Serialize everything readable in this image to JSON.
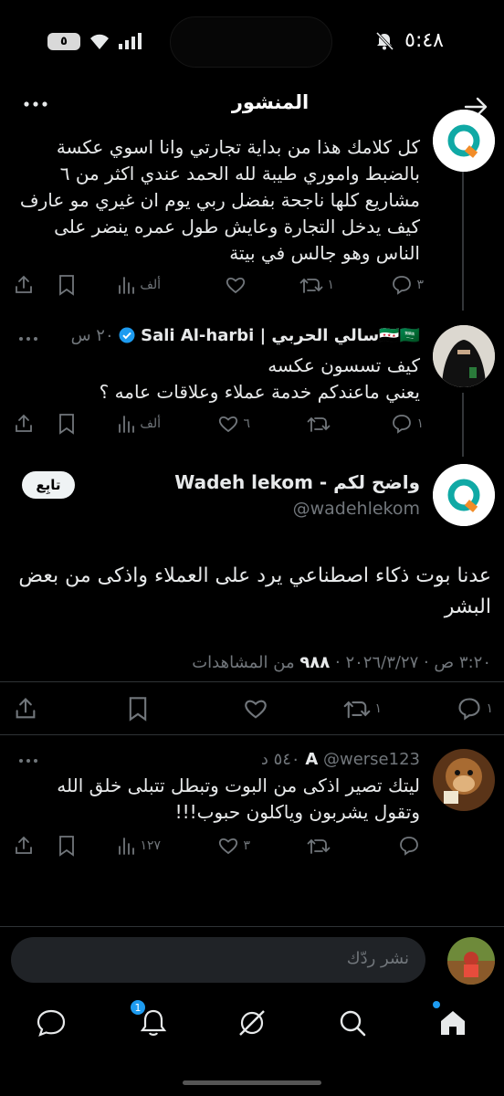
{
  "status_bar": {
    "time": "٥:٤٨",
    "battery": "٥"
  },
  "header": {
    "title": "المنشور"
  },
  "posts": [
    {
      "text": "كل كلامك هذا من بداية تجارتي وانا اسوي عكسة بالضبط واموري طيبة لله الحمد عندي اكثر من ٦ مشاريع كلها ناجحة بفضل ربي يوم ان غيري مو عارف كيف يدخل التجارة وعايش طول عمره ينضر على الناس وهو جالس في بيتة",
      "stats": {
        "replies": "٣",
        "reposts": "١",
        "likes": "",
        "views": "ألف"
      }
    },
    {
      "author_name": "🇸🇾🇸🇦سالي الحربي | Sali Al-harbi",
      "time": "٢٠ س",
      "text": "كيف تسسون عكسه\nيعني ماعندكم خدمة عملاء وعلاقات عامه ؟",
      "stats": {
        "replies": "١",
        "reposts": "",
        "likes": "٦",
        "views": "ألف"
      }
    }
  ],
  "main_post": {
    "author_name": "واضح لكم - Wadeh lekom",
    "handle": "@wadehlekom",
    "follow_label": "تابِع",
    "text": "عدنا بوت ذكاء اصطناعي يرد على العملاء واذكى من بعض البشر",
    "timestamp": "٣:٢٠ ص · ٢٠٢٦/٣/٢٧ · ",
    "views_count": "٩٨٨",
    "views_label": " من المشاهدات",
    "stats": {
      "replies": "١",
      "reposts": "١",
      "likes": "",
      "bookmarks": ""
    }
  },
  "reply": {
    "author_name": "A",
    "handle": "@werse123",
    "time": "٥٤٠ د",
    "text": "ليتك تصير اذكى من البوت وتبطل تتبلى خلق الله وتقول يشربون وياكلون حبوب!!!",
    "stats": {
      "replies": "",
      "reposts": "",
      "likes": "٣",
      "views": "١٢٧"
    }
  },
  "composer": {
    "placeholder": "نشر ردّك"
  },
  "nav": {
    "notifications_badge": "1"
  },
  "colors": {
    "background": "#000000",
    "text": "#e7e9ea",
    "muted": "#71767b",
    "accent": "#1d9bf0",
    "verified": "#1d9bf0",
    "logo_teal": "#10a9a5",
    "logo_orange": "#f28c28"
  }
}
